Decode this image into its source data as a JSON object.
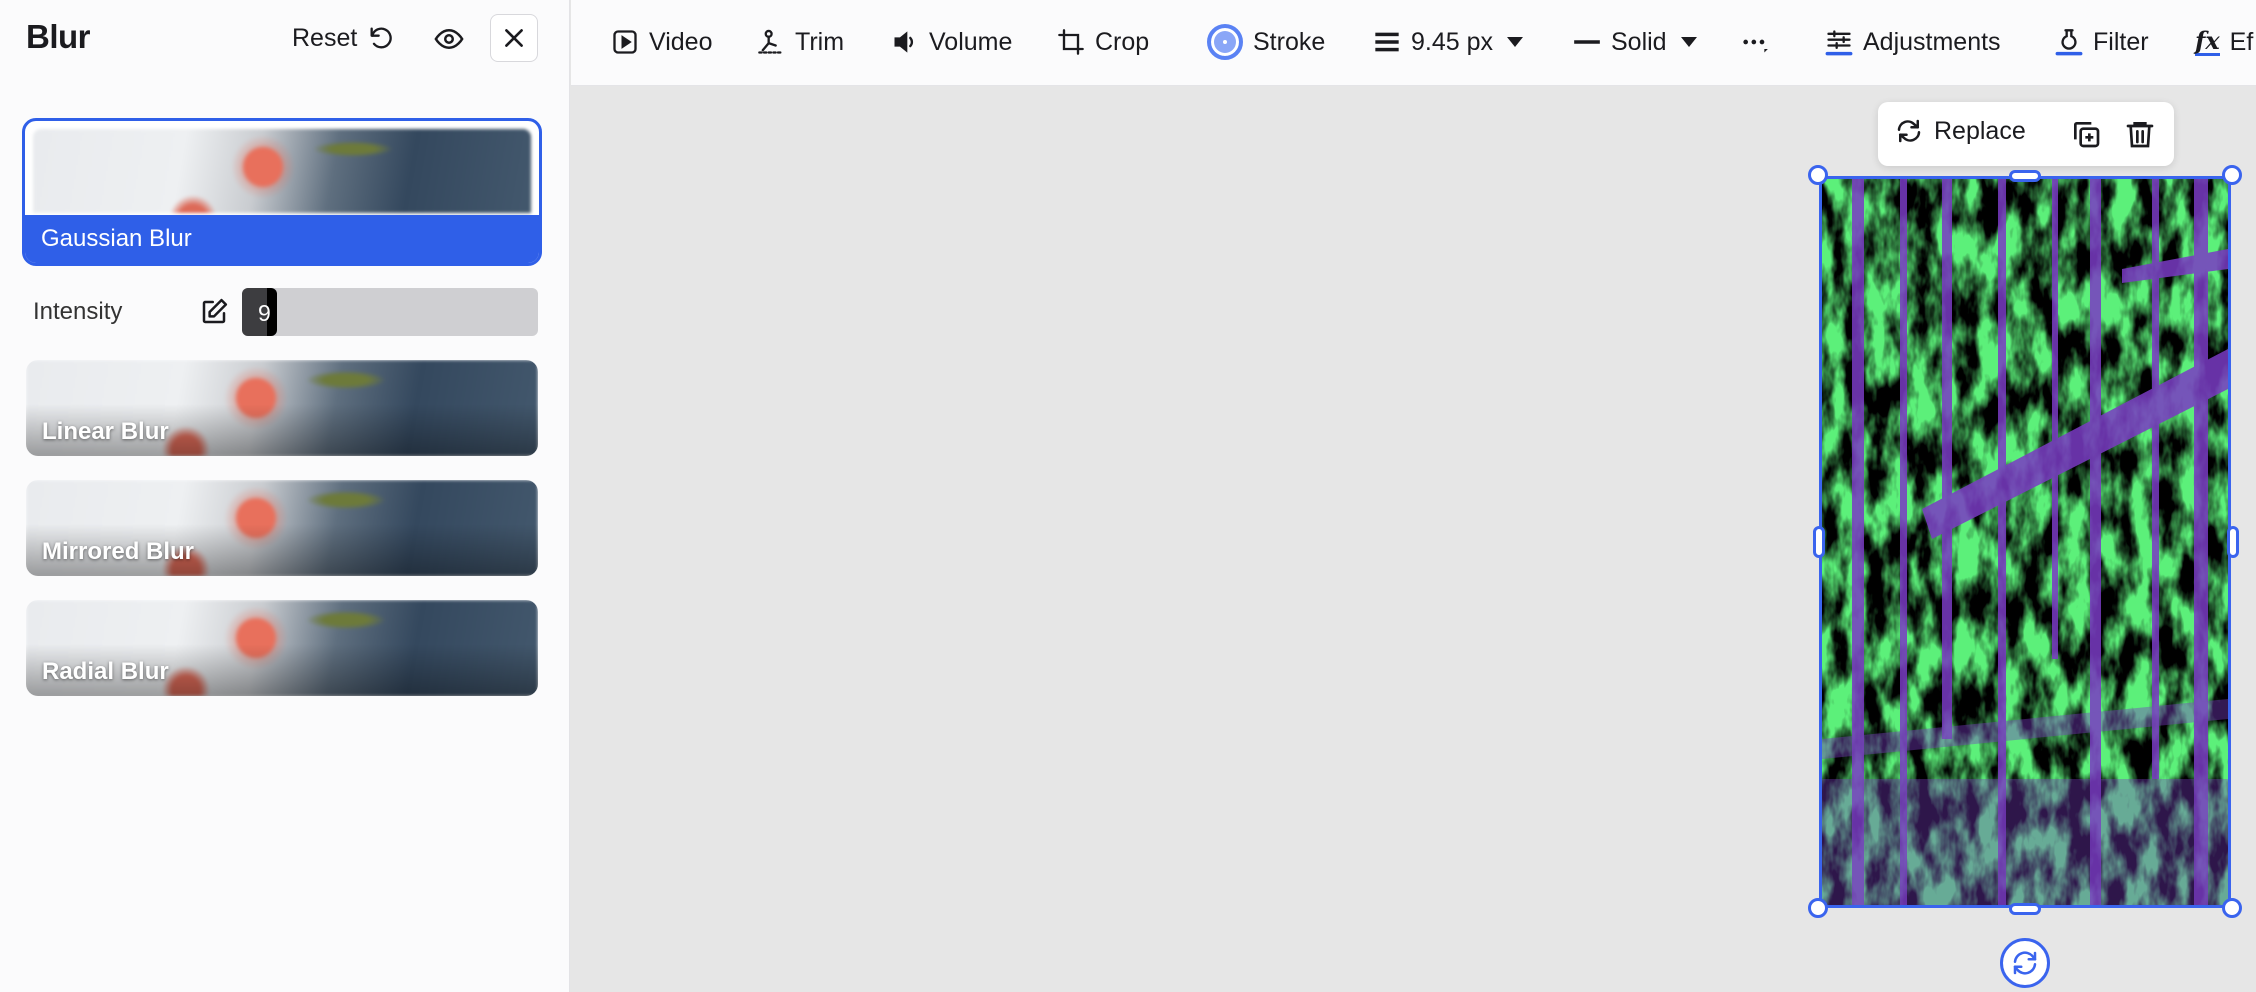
{
  "panel": {
    "title": "Blur",
    "reset_label": "Reset",
    "intensity": {
      "label": "Intensity",
      "value": "9",
      "fraction": 0.09
    }
  },
  "blur_options": [
    {
      "label": "Gaussian Blur",
      "selected": true
    },
    {
      "label": "Linear Blur",
      "selected": false
    },
    {
      "label": "Mirrored Blur",
      "selected": false
    },
    {
      "label": "Radial Blur",
      "selected": false
    }
  ],
  "toolbar": {
    "video": "Video",
    "trim": "Trim",
    "volume": "Volume",
    "crop": "Crop",
    "stroke": "Stroke",
    "stroke_width": "9.45 px",
    "stroke_style": "Solid",
    "adjustments": "Adjustments",
    "filter": "Filter",
    "effects": "Ef"
  },
  "selection": {
    "replace_label": "Replace"
  },
  "colors": {
    "accent": "#2f5fe8",
    "image_green": "#5cf07a",
    "image_purple": "#7a3bc4"
  }
}
